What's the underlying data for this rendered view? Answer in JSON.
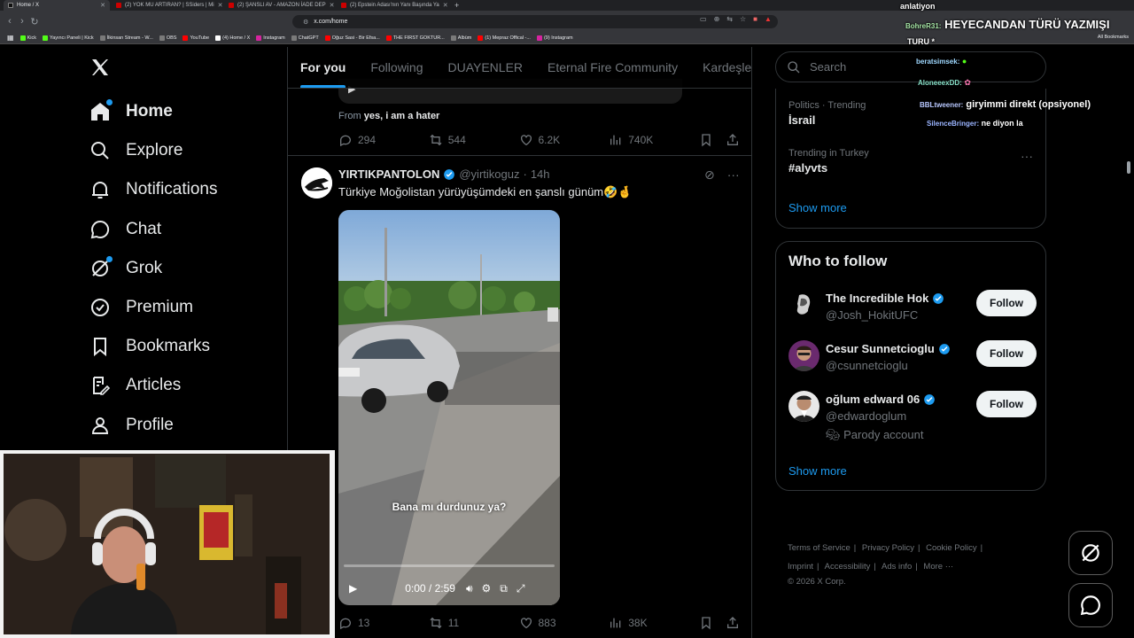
{
  "browser": {
    "tabs": [
      {
        "label": "Home / X",
        "active": true
      },
      {
        "label": "(2) YOK MU ARTIRAN? | SSiders | Mi"
      },
      {
        "label": "(2) ŞANSLI AV - AMAZON İADE DEP"
      },
      {
        "label": "(2) Epstein Adası'nın Yanı Başında Ya"
      }
    ],
    "url": "x.com/home",
    "bookmarks": [
      "Kick",
      "Yayıncı Paneli | Kick",
      "İlkinsan Stream - W...",
      "OBS",
      "YouTube",
      "(4) Home / X",
      "Instagram",
      "ChatGPT",
      "Oğuz Sasi - Bir Efsa...",
      "THE FIRST GOKTUR...",
      "Albüm",
      "(1) Mepraz Offical -...",
      "(9) Instagram"
    ],
    "all_bookmarks": "All Bookmarks"
  },
  "nav": {
    "items": [
      {
        "label": "Home",
        "icon": "home-icon"
      },
      {
        "label": "Explore",
        "icon": "search-icon"
      },
      {
        "label": "Notifications",
        "icon": "bell-icon"
      },
      {
        "label": "Chat",
        "icon": "chat-icon"
      },
      {
        "label": "Grok",
        "icon": "grok-icon"
      },
      {
        "label": "Premium",
        "icon": "premium-icon"
      },
      {
        "label": "Bookmarks",
        "icon": "bookmark-icon"
      },
      {
        "label": "Articles",
        "icon": "articles-icon"
      },
      {
        "label": "Profile",
        "icon": "profile-icon"
      }
    ]
  },
  "feed_tabs": [
    "For you",
    "Following",
    "DUAYENLER",
    "Eternal Fire Community",
    "Kardeşler K"
  ],
  "prev_tweet": {
    "from_prefix": "From",
    "from_name": "yes, i am a hater",
    "replies": "294",
    "reposts": "544",
    "likes": "6.2K",
    "views": "740K"
  },
  "tweet": {
    "name": "YIRTIKPANTOLON",
    "handle": "@yirtikoguz",
    "sep": "·",
    "time": "14h",
    "text": "Türkiye Moğolistan yürüyüşümdeki en şanslı günüm🤣🤞",
    "video_caption": "Bana mı durdunuz ya?",
    "video_time": "0:00 / 2:59",
    "replies": "13",
    "reposts": "11",
    "likes": "883",
    "views": "38K"
  },
  "search": {
    "placeholder": "Search"
  },
  "trends": [
    {
      "context": "Politics · Trending",
      "title": "İsrail"
    },
    {
      "context": "Trending in Turkey",
      "title": "#alyvts"
    }
  ],
  "show_more": "Show more",
  "who_to_follow": {
    "title": "Who to follow",
    "users": [
      {
        "name": "The Incredible Hok",
        "handle": "@Josh_HokitUFC",
        "button": "Follow"
      },
      {
        "name": "Cesur Sunnetcioglu",
        "handle": "@csunnetcioglu",
        "button": "Follow"
      },
      {
        "name": "oğlum edward 06",
        "handle": "@edwardoglum",
        "extra": "Parody account",
        "button": "Follow"
      }
    ],
    "show_more": "Show more"
  },
  "footer": {
    "links": [
      "Terms of Service",
      "|",
      "Privacy Policy",
      "|",
      "Cookie Policy",
      "|",
      "Imprint",
      "|",
      "Accessibility",
      "|",
      "Ads info",
      "|",
      "More ···"
    ],
    "copyright": "© 2026 X Corp."
  },
  "chat_overlay": [
    {
      "user": "",
      "msg": "anlatiyon"
    },
    {
      "user": "BohreR31:",
      "msg": "HEYECANDAN TÜRÜ YAZMIŞI"
    },
    {
      "user": "",
      "msg": "TURU *"
    },
    {
      "user": "beratsimsek:",
      "msg": ""
    },
    {
      "user": "AloneeexDD:",
      "msg": ""
    },
    {
      "user": "BBLtweener:",
      "msg": "giryimmi direkt (opsiyonel)"
    },
    {
      "user": "SilenceBringer:",
      "msg": "ne diyon la"
    }
  ],
  "colors": {
    "accent": "#1d9bf0",
    "background": "#000000",
    "border": "#2f3336",
    "muted": "#71767b"
  }
}
